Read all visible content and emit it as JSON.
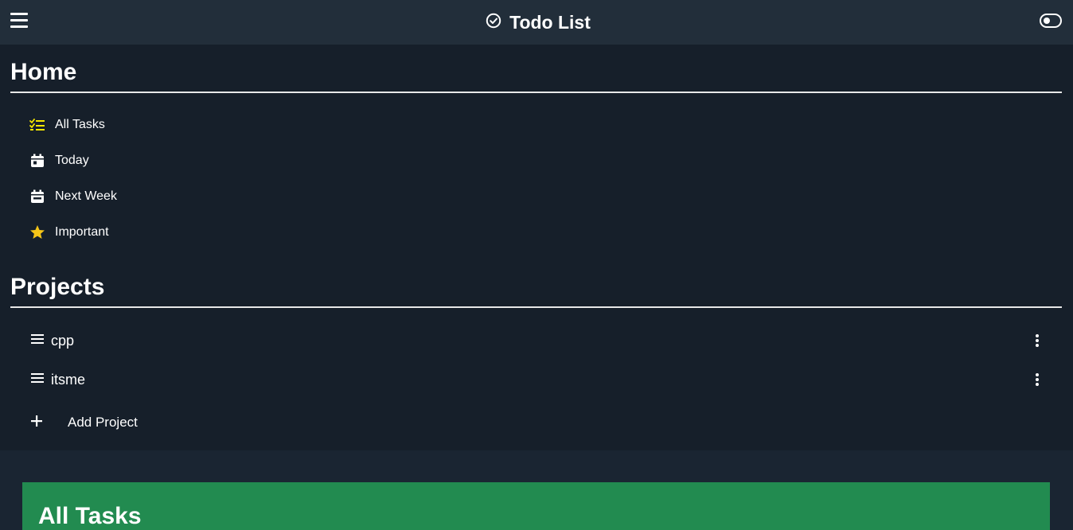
{
  "header": {
    "title": "Todo List",
    "menu_icon": "hamburger-menu-icon",
    "title_icon": "check-circle-icon",
    "theme_toggle_icon": "toggle-icon"
  },
  "home": {
    "title": "Home",
    "items": [
      {
        "label": "All Tasks",
        "icon": "task-list-icon",
        "icon_color": "#f5e700"
      },
      {
        "label": "Today",
        "icon": "calendar-day-icon",
        "icon_color": "#ffffff"
      },
      {
        "label": "Next Week",
        "icon": "calendar-week-icon",
        "icon_color": "#ffffff"
      },
      {
        "label": "Important",
        "icon": "star-icon",
        "icon_color": "#f5c518"
      }
    ]
  },
  "projects": {
    "title": "Projects",
    "items": [
      {
        "label": "cpp",
        "icon": "list-icon",
        "menu_icon": "more-vertical-icon"
      },
      {
        "label": "itsme",
        "icon": "list-icon",
        "menu_icon": "more-vertical-icon"
      }
    ],
    "add_label": "Add Project",
    "add_icon": "plus-icon"
  },
  "main": {
    "title": "All Tasks",
    "header_color": "#228b50"
  },
  "colors": {
    "topbar": "#222e3a",
    "sidebar": "#161f2a",
    "background": "#1a2532"
  }
}
